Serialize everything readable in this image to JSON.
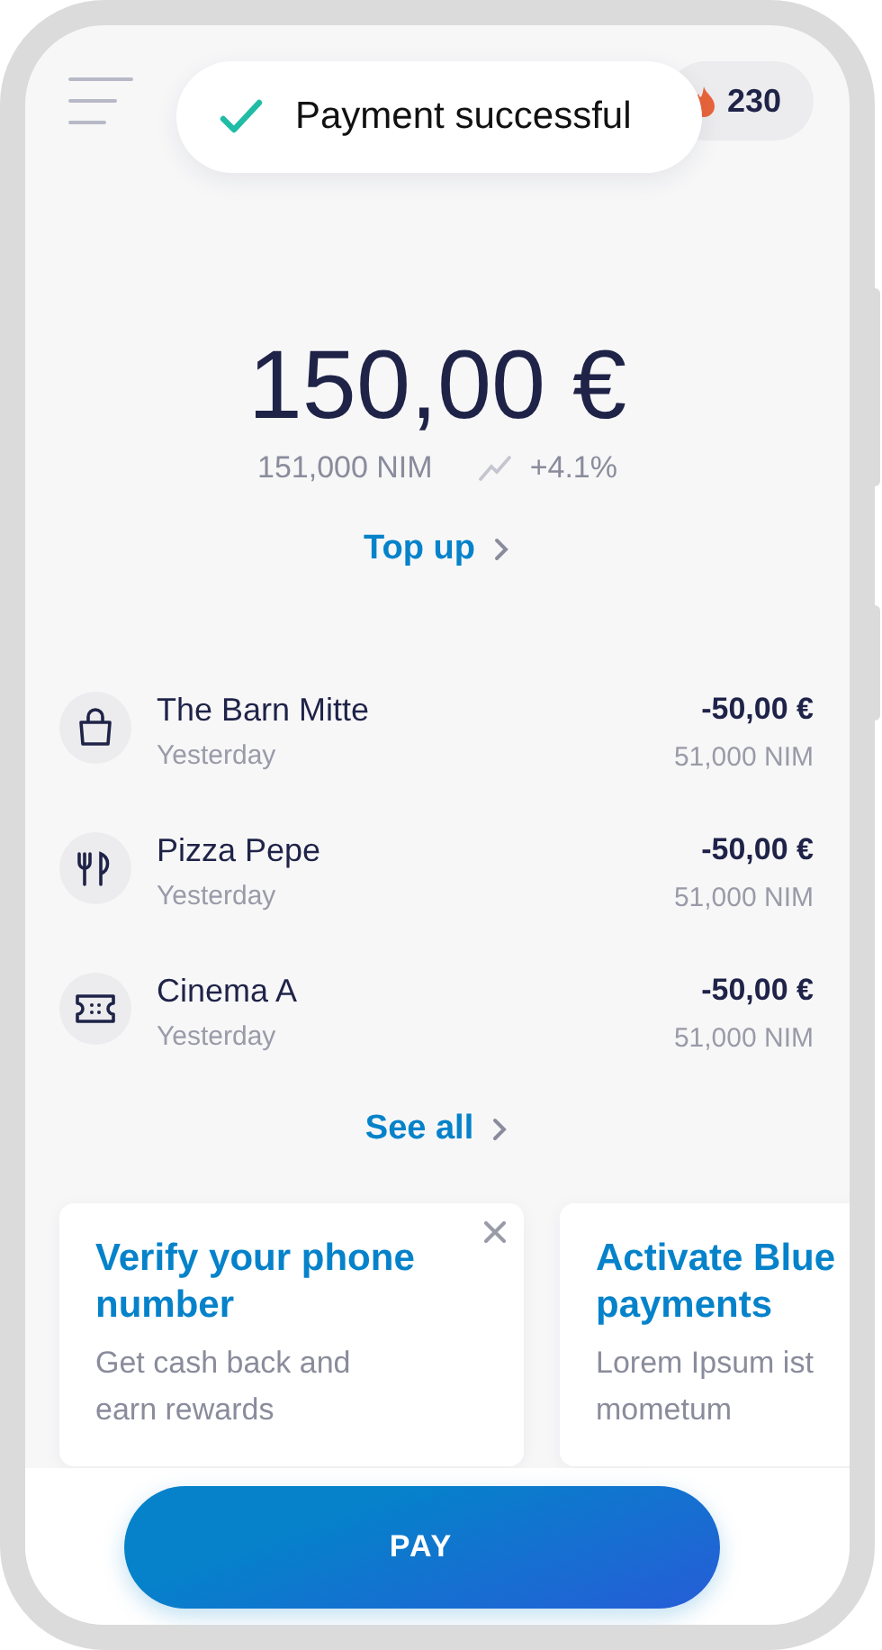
{
  "header": {
    "points": "230"
  },
  "toast": {
    "message": "Payment successful"
  },
  "balance": {
    "amount": "150,00 €",
    "crypto": "151,000 NIM",
    "change": "+4.1%"
  },
  "top_up": "Top up",
  "transactions": [
    {
      "kind": "shopping",
      "name": "The Barn Mitte",
      "date": "Yesterday",
      "amount": "-50,00 €",
      "crypto": "51,000 NIM"
    },
    {
      "kind": "restaurant",
      "name": "Pizza Pepe",
      "date": "Yesterday",
      "amount": "-50,00 €",
      "crypto": "51,000 NIM"
    },
    {
      "kind": "ticket",
      "name": "Cinema A",
      "date": "Yesterday",
      "amount": "-50,00 €",
      "crypto": "51,000 NIM"
    }
  ],
  "see_all": "See all",
  "cards": [
    {
      "title": "Verify your phone number",
      "text": "Get cash back and earn rewards",
      "dismissible": true
    },
    {
      "title": "Activate Blue payments",
      "text": "Lorem Ipsum ist mometum"
    }
  ],
  "pay_button": "PAY"
}
